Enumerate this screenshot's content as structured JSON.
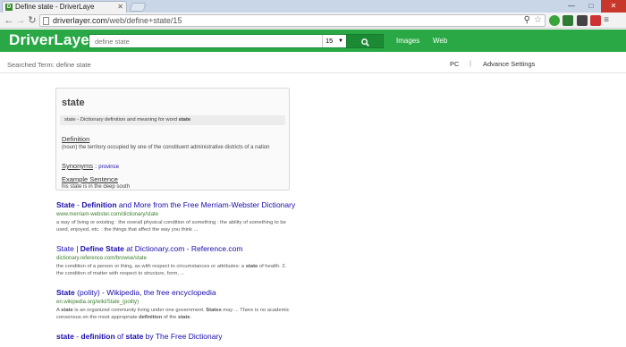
{
  "browser": {
    "tab_title": "Define state - DriverLaye",
    "tab_favicon": "D",
    "url_host": "driverlayer.com",
    "url_path": "/web/define+state/15",
    "window_buttons": [
      "—",
      "□",
      "✕"
    ]
  },
  "header": {
    "logo": "DriverLayer",
    "search_placeholder": "define state",
    "result_count": "15",
    "nav": [
      "Images",
      "Web"
    ]
  },
  "subheader": {
    "searched_label": "Searched Term:",
    "searched_term": "define state",
    "pc": "PC",
    "separator": "|",
    "advance": "Advance Settings"
  },
  "definition_card": {
    "word": "state",
    "meaning_text": "state - Dictionary definition and meaning for word",
    "meaning_word": "state",
    "definition_title": "Definition",
    "definition_text": "(noun) the territory occupied by one of the constituent administrative districts of a nation",
    "synonyms_title": "Synonyms",
    "synonyms_sep": ":",
    "synonym": "province",
    "example_title": "Example Sentence",
    "example_text": "his state is in the deep south"
  },
  "results": [
    {
      "title_parts": [
        {
          "text": "State",
          "bold": true
        },
        {
          "text": " - ",
          "bold": false
        },
        {
          "text": "Definition",
          "bold": true
        },
        {
          "text": " and More from the Free Merriam-Webster Dictionary",
          "bold": false
        }
      ],
      "url": "www.merriam-webster.com/dictionary/state",
      "snippet_parts": [
        {
          "text": "a way of living or existing : the overall physical condition of something : the ability of something to be used, enjoyed, etc. : the things that affect the way you think ...",
          "bold": false
        }
      ]
    },
    {
      "title_parts": [
        {
          "text": "State | ",
          "bold": false
        },
        {
          "text": "Define State",
          "bold": true
        },
        {
          "text": " at Dictionary.com - Reference.com",
          "bold": false
        }
      ],
      "url": "dictionary.reference.com/browse/state",
      "snippet_parts": [
        {
          "text": "the condition of a person or thing, as with respect to circumstances or attributes: a ",
          "bold": false
        },
        {
          "text": "state",
          "bold": true
        },
        {
          "text": " of health. 2. the condition of matter with respect to structure, form, ...",
          "bold": false
        }
      ]
    },
    {
      "title_parts": [
        {
          "text": "State",
          "bold": true
        },
        {
          "text": " (polity) - Wikipedia, the free encyclopedia",
          "bold": false
        }
      ],
      "url": "en.wikipedia.org/wiki/State_(polity)",
      "snippet_parts": [
        {
          "text": "A ",
          "bold": false
        },
        {
          "text": "state",
          "bold": true
        },
        {
          "text": " is an organized community living under one government. ",
          "bold": false
        },
        {
          "text": "States",
          "bold": true
        },
        {
          "text": " may ... There is no academic consensus on the most appropriate ",
          "bold": false
        },
        {
          "text": "definition",
          "bold": true
        },
        {
          "text": " of the ",
          "bold": false
        },
        {
          "text": "state",
          "bold": true
        },
        {
          "text": ".",
          "bold": false
        }
      ]
    },
    {
      "title_parts": [
        {
          "text": "state",
          "bold": true
        },
        {
          "text": " - ",
          "bold": false
        },
        {
          "text": "definition",
          "bold": true
        },
        {
          "text": " of ",
          "bold": false
        },
        {
          "text": "state",
          "bold": true
        },
        {
          "text": " by The Free Dictionary",
          "bold": false
        }
      ],
      "url": "",
      "snippet_parts": []
    }
  ],
  "colors": {
    "header_green": "#29a845",
    "link_blue": "#1a0dab",
    "url_green": "#3b7d2e"
  },
  "icons": [
    "back-arrow-icon",
    "forward-arrow-icon",
    "reload-icon",
    "page-icon",
    "zoom-icon",
    "star-icon",
    "search-icon",
    "menu-icon"
  ]
}
